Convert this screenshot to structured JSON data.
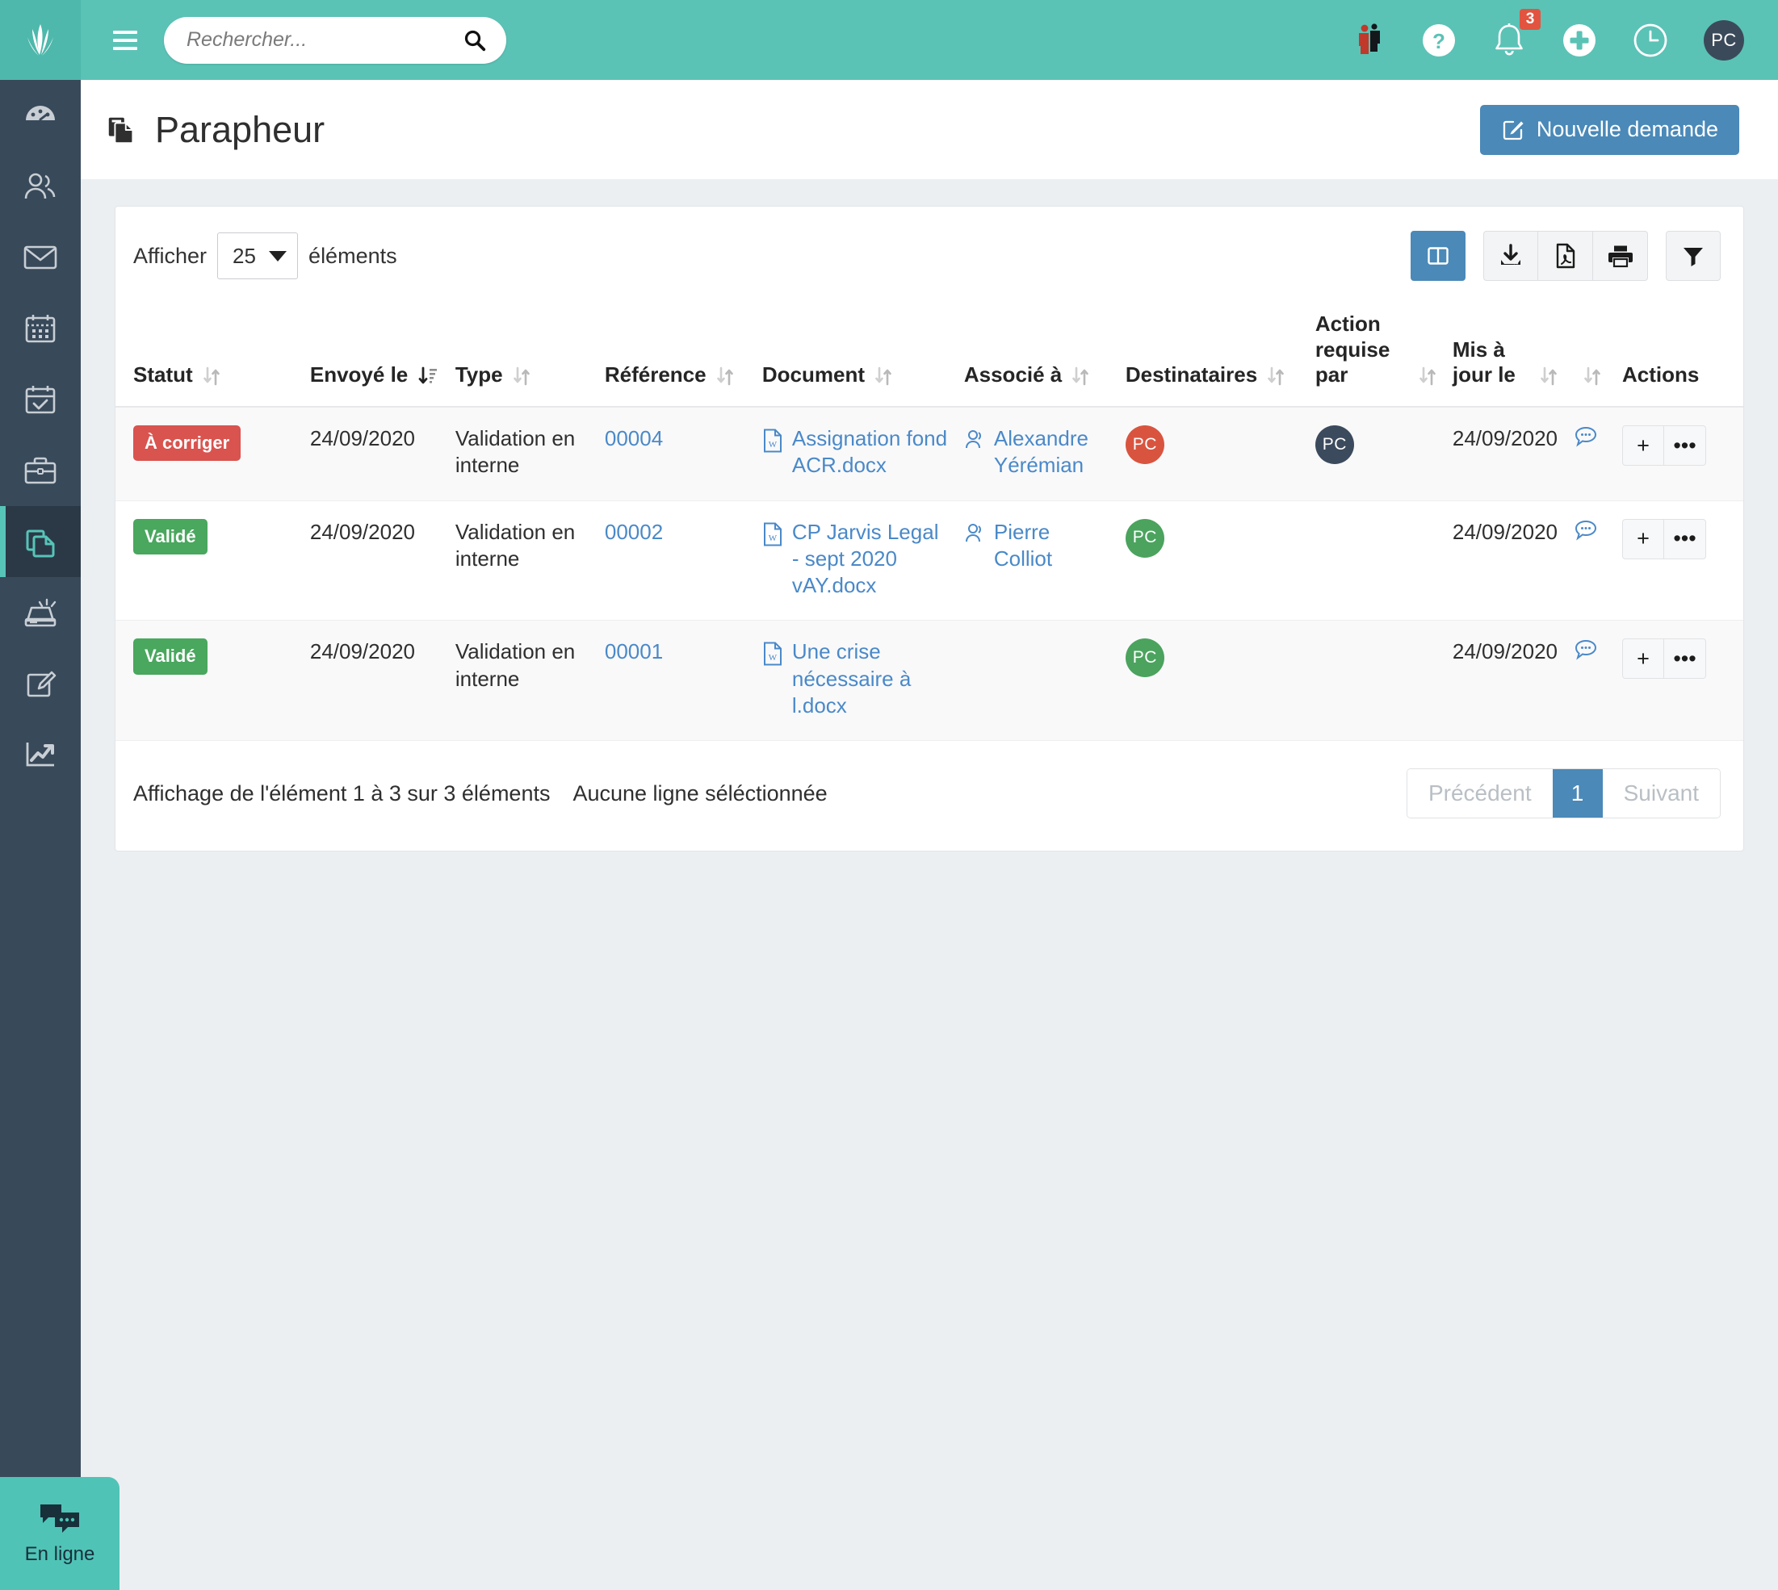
{
  "header": {
    "logo": "jarvis-leaf-logo",
    "menu_icon": "hamburger-icon",
    "search": {
      "placeholder": "Rechercher...",
      "value": "",
      "icon": "search-icon"
    },
    "icons": [
      {
        "name": "people-icon"
      },
      {
        "name": "help-icon"
      },
      {
        "name": "notifications-bell-icon",
        "badge": "3"
      },
      {
        "name": "add-circle-icon"
      },
      {
        "name": "clock-history-icon"
      }
    ],
    "avatar": {
      "initials": "PC"
    },
    "accent_color": "#5bc2b6",
    "badge_color": "#e2543f"
  },
  "sidebar": {
    "items": [
      {
        "icon": "dashboard-gauge-icon",
        "active": false
      },
      {
        "icon": "contacts-users-icon",
        "active": false
      },
      {
        "icon": "mail-envelope-icon",
        "active": false
      },
      {
        "icon": "calendar-icon",
        "active": false
      },
      {
        "icon": "calendar-check-icon",
        "active": false
      },
      {
        "icon": "briefcase-icon",
        "active": false
      },
      {
        "icon": "documents-copy-icon",
        "active": true
      },
      {
        "icon": "scanner-icon",
        "active": false
      },
      {
        "icon": "edit-square-icon",
        "active": false
      },
      {
        "icon": "analytics-chart-icon",
        "active": false
      }
    ],
    "active_color": "#57c4b8"
  },
  "page": {
    "title": "Parapheur",
    "title_icon": "documents-copy-icon",
    "new_request_button": {
      "label": "Nouvelle demande",
      "icon": "edit-pen-square-icon",
      "color": "#4a89b8"
    }
  },
  "toolbar": {
    "show_label": "Afficher",
    "page_size": "25",
    "elements_label": "éléments",
    "buttons": [
      {
        "name": "columns-toggle-button",
        "icon": "columns-icon",
        "active": true
      },
      {
        "name": "export-download-button",
        "icon": "download-icon",
        "active": false
      },
      {
        "name": "export-pdf-button",
        "icon": "pdf-file-icon",
        "active": false
      },
      {
        "name": "print-button",
        "icon": "printer-icon",
        "active": false
      },
      {
        "name": "filter-button",
        "icon": "filter-funnel-icon",
        "active": false
      }
    ]
  },
  "table": {
    "columns": [
      {
        "label": "Statut",
        "sort": "both"
      },
      {
        "label": "Envoyé le",
        "sort": "desc-active"
      },
      {
        "label": "Type",
        "sort": "both"
      },
      {
        "label": "Référence",
        "sort": "both"
      },
      {
        "label": "Document",
        "sort": "both"
      },
      {
        "label": "Associé à",
        "sort": "both"
      },
      {
        "label": "Destinataires",
        "sort": "both"
      },
      {
        "label": "Action requise par",
        "sort": "both"
      },
      {
        "label": "Mis à jour le",
        "sort": "both"
      },
      {
        "label": "",
        "sort": "both"
      },
      {
        "label": "Actions",
        "sort": "none"
      }
    ],
    "rows": [
      {
        "statut": "À corriger",
        "statut_color": "red",
        "envoye_le": "24/09/2020",
        "type": "Validation en interne",
        "reference": "00004",
        "document": "Assignation fond ACR.docx",
        "document_icon": "word-file-icon",
        "associe_a": "Alexandre Yérémian",
        "associe_icon": "user-icon",
        "destinataires": [
          {
            "initials": "PC",
            "color": "red"
          }
        ],
        "action_requise_par": [
          {
            "initials": "PC",
            "color": "navy"
          }
        ],
        "mis_a_jour_le": "24/09/2020",
        "comment_icon": "comment-bubble-icon",
        "actions": [
          {
            "name": "add-action-button",
            "label": "+"
          },
          {
            "name": "more-actions-button",
            "label": "•••"
          }
        ]
      },
      {
        "statut": "Validé",
        "statut_color": "green",
        "envoye_le": "24/09/2020",
        "type": "Validation en interne",
        "reference": "00002",
        "document": "CP Jarvis Legal - sept 2020 vAY.docx",
        "document_icon": "word-file-icon",
        "associe_a": "Pierre Colliot",
        "associe_icon": "user-icon",
        "destinataires": [
          {
            "initials": "PC",
            "color": "green"
          }
        ],
        "action_requise_par": [],
        "mis_a_jour_le": "24/09/2020",
        "comment_icon": "comment-bubble-icon",
        "actions": [
          {
            "name": "add-action-button",
            "label": "+"
          },
          {
            "name": "more-actions-button",
            "label": "•••"
          }
        ]
      },
      {
        "statut": "Validé",
        "statut_color": "green",
        "envoye_le": "24/09/2020",
        "type": "Validation en interne",
        "reference": "00001",
        "document": "Une crise nécessaire à l.docx",
        "document_icon": "word-file-icon",
        "associe_a": "",
        "associe_icon": "",
        "destinataires": [
          {
            "initials": "PC",
            "color": "green"
          }
        ],
        "action_requise_par": [],
        "mis_a_jour_le": "24/09/2020",
        "comment_icon": "comment-bubble-icon",
        "actions": [
          {
            "name": "add-action-button",
            "label": "+"
          },
          {
            "name": "more-actions-button",
            "label": "•••"
          }
        ]
      }
    ]
  },
  "footer": {
    "showing": "Affichage de l'élément 1 à 3 sur 3 éléments",
    "selection": "Aucune ligne séléctionnée",
    "pagination": {
      "previous": "Précédent",
      "current": "1",
      "next": "Suivant"
    }
  },
  "chat_widget": {
    "label": "En ligne",
    "icon": "chat-bubbles-icon",
    "color": "#50c3b7"
  }
}
